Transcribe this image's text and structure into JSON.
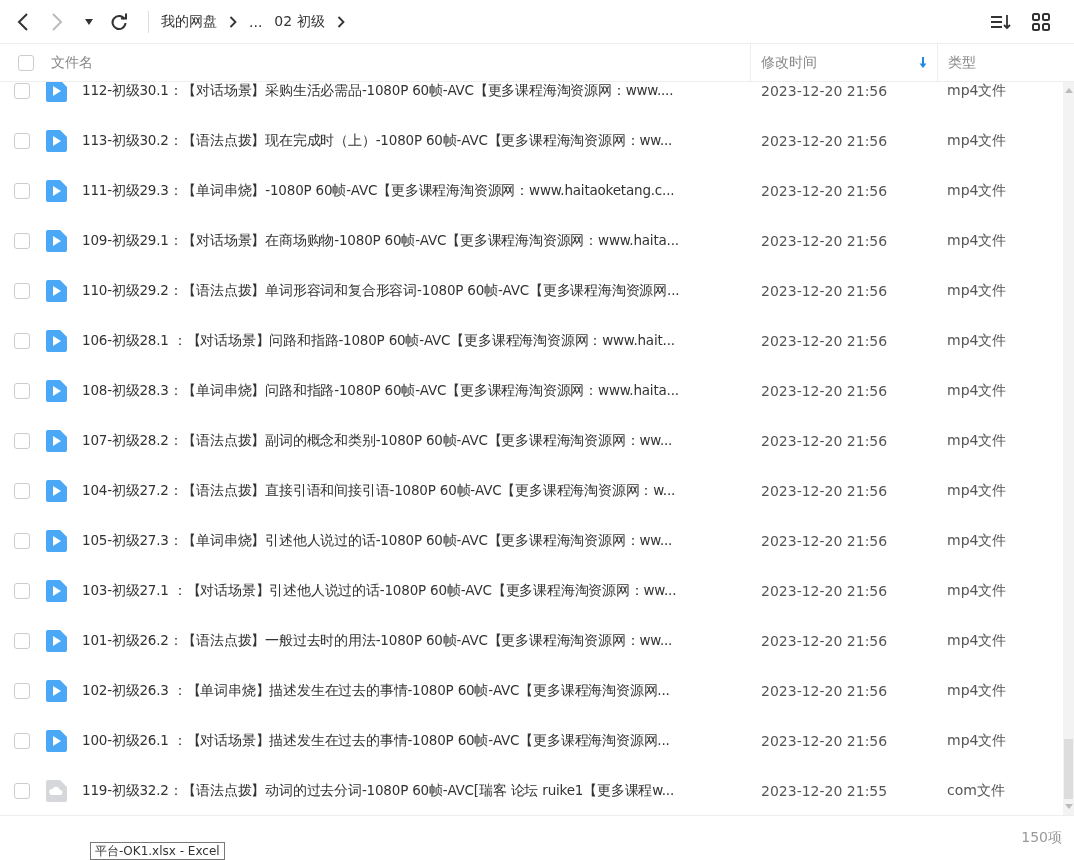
{
  "toolbar": {
    "breadcrumb": [
      "我的网盘",
      "...",
      "02 初级"
    ]
  },
  "table": {
    "select_all": {
      "checked": false
    },
    "columns": [
      {
        "label": "文件名",
        "sorted": false
      },
      {
        "label": "修改时间",
        "sorted": true
      },
      {
        "label": "类型",
        "sorted": false
      }
    ],
    "rows": [
      {
        "kind": "video",
        "checked": false,
        "name": "112-初级30.1：【对话场景】采购生活必需品-1080P 60帧-AVC【更多课程海淘资源网：www....",
        "modified": "2023-12-20 21:56",
        "type": "mp4文件"
      },
      {
        "kind": "video",
        "checked": false,
        "name": "113-初级30.2：【语法点拨】现在完成时（上）-1080P 60帧-AVC【更多课程海淘资源网：ww...",
        "modified": "2023-12-20 21:56",
        "type": "mp4文件"
      },
      {
        "kind": "video",
        "checked": false,
        "name": "111-初级29.3：【单词串烧】-1080P 60帧-AVC【更多课程海淘资源网：www.haitaoketang.c...",
        "modified": "2023-12-20 21:56",
        "type": "mp4文件"
      },
      {
        "kind": "video",
        "checked": false,
        "name": "109-初级29.1：【对话场景】在商场购物-1080P 60帧-AVC【更多课程海淘资源网：www.haita...",
        "modified": "2023-12-20 21:56",
        "type": "mp4文件"
      },
      {
        "kind": "video",
        "checked": false,
        "name": "110-初级29.2：【语法点拨】单词形容词和复合形容词-1080P 60帧-AVC【更多课程海淘资源网...",
        "modified": "2023-12-20 21:56",
        "type": "mp4文件"
      },
      {
        "kind": "video",
        "checked": false,
        "name": "106-初级28.1 ：【对话场景】问路和指路-1080P 60帧-AVC【更多课程海淘资源网：www.hait...",
        "modified": "2023-12-20 21:56",
        "type": "mp4文件"
      },
      {
        "kind": "video",
        "checked": false,
        "name": "108-初级28.3：【单词串烧】问路和指路-1080P 60帧-AVC【更多课程海淘资源网：www.haita...",
        "modified": "2023-12-20 21:56",
        "type": "mp4文件"
      },
      {
        "kind": "video",
        "checked": false,
        "name": "107-初级28.2：【语法点拨】副词的概念和类别-1080P 60帧-AVC【更多课程海淘资源网：ww...",
        "modified": "2023-12-20 21:56",
        "type": "mp4文件"
      },
      {
        "kind": "video",
        "checked": false,
        "name": "104-初级27.2：【语法点拨】直接引语和间接引语-1080P 60帧-AVC【更多课程海淘资源网：w...",
        "modified": "2023-12-20 21:56",
        "type": "mp4文件"
      },
      {
        "kind": "video",
        "checked": false,
        "name": "105-初级27.3：【单词串烧】引述他人说过的话-1080P 60帧-AVC【更多课程海淘资源网：ww...",
        "modified": "2023-12-20 21:56",
        "type": "mp4文件"
      },
      {
        "kind": "video",
        "checked": false,
        "name": "103-初级27.1 ：【对话场景】引述他人说过的话-1080P 60帧-AVC【更多课程海淘资源网：ww...",
        "modified": "2023-12-20 21:56",
        "type": "mp4文件"
      },
      {
        "kind": "video",
        "checked": false,
        "name": "101-初级26.2：【语法点拨】一般过去时的用法-1080P 60帧-AVC【更多课程海淘资源网：ww...",
        "modified": "2023-12-20 21:56",
        "type": "mp4文件"
      },
      {
        "kind": "video",
        "checked": false,
        "name": "102-初级26.3 ：【单词串烧】描述发生在过去的事情-1080P 60帧-AVC【更多课程海淘资源网...",
        "modified": "2023-12-20 21:56",
        "type": "mp4文件"
      },
      {
        "kind": "video",
        "checked": false,
        "name": "100-初级26.1 ：【对话场景】描述发生在过去的事情-1080P 60帧-AVC【更多课程海淘资源网...",
        "modified": "2023-12-20 21:56",
        "type": "mp4文件"
      },
      {
        "kind": "other",
        "checked": false,
        "name": "119-初级32.2：【语法点拨】动词的过去分词-1080P 60帧-AVC[瑞客 论坛 ruike1【更多课程w...",
        "modified": "2023-12-20 21:55",
        "type": "com文件"
      }
    ]
  },
  "status_bar": {
    "count": "150项"
  },
  "tooltip": {
    "text": "平台-OK1.xlsx - Excel"
  }
}
